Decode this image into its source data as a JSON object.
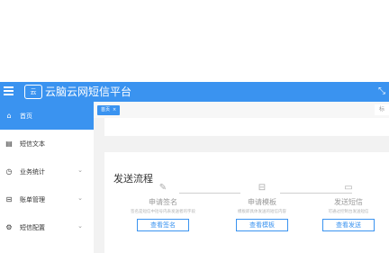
{
  "header": {
    "app_title": "云脑云网短信平台",
    "logo_text": "云"
  },
  "sidebar": {
    "items": [
      {
        "label": "首页",
        "icon": "home-icon",
        "active": true,
        "has_children": false
      },
      {
        "label": "短信文本",
        "icon": "document-icon",
        "active": false,
        "has_children": false
      },
      {
        "label": "业务统计",
        "icon": "clock-icon",
        "active": false,
        "has_children": true
      },
      {
        "label": "账单管理",
        "icon": "database-icon",
        "active": false,
        "has_children": true
      },
      {
        "label": "短信配置",
        "icon": "gear-icon",
        "active": false,
        "has_children": true
      }
    ]
  },
  "tabs": {
    "items": [
      {
        "label": "首页",
        "close": "×"
      }
    ],
    "more": "标"
  },
  "process": {
    "title": "发送流程",
    "steps": [
      {
        "name": "申请签名",
        "desc": "签名是短信中括号内表发送者的字段",
        "button": "查看签名",
        "icon": "edit-icon"
      },
      {
        "name": "申请模板",
        "desc": "模板即具体发送的短信内容",
        "button": "查看模板",
        "icon": "save-icon"
      },
      {
        "name": "发送短信",
        "desc": "可通过控制台发送短信",
        "button": "查看发送",
        "icon": "chat-icon"
      }
    ]
  },
  "colors": {
    "primary": "#3a93f0",
    "background": "#f2f2f2"
  }
}
